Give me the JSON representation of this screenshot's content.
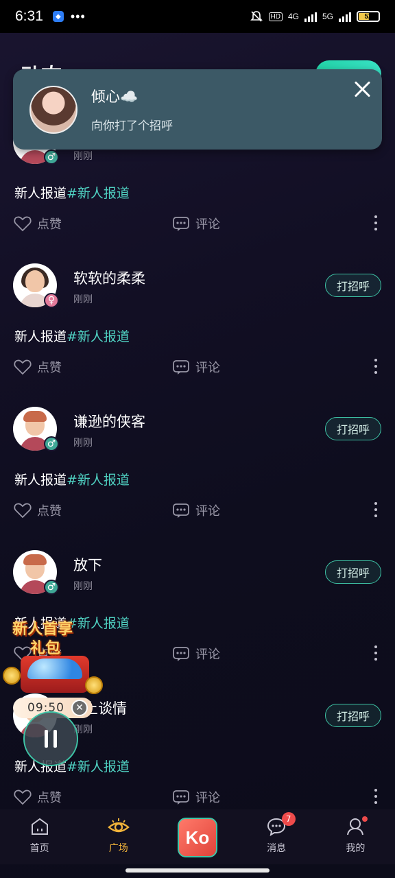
{
  "status_bar": {
    "time": "6:31",
    "network1": "4G",
    "network2": "5G",
    "hd": "HD",
    "battery": "52",
    "battery_percent": 52
  },
  "header": {
    "title": "动态"
  },
  "notification": {
    "name": "倾心☁️",
    "message": "向你打了个招呼"
  },
  "posts": [
    {
      "name": "",
      "time": "刚刚",
      "gender": "male",
      "content": "新人报道",
      "tag": "#新人报道",
      "like_label": "点赞",
      "comment_label": "评论"
    },
    {
      "name": "软软的柔柔",
      "time": "刚刚",
      "gender": "female",
      "greet_label": "打招呼",
      "content": "新人报道",
      "tag": "#新人报道",
      "like_label": "点赞",
      "comment_label": "评论"
    },
    {
      "name": "谦逊的侠客",
      "time": "刚刚",
      "gender": "male",
      "greet_label": "打招呼",
      "content": "新人报道",
      "tag": "#新人报道",
      "like_label": "点赞",
      "comment_label": "评论"
    },
    {
      "name": "放下",
      "time": "刚刚",
      "gender": "male",
      "greet_label": "打招呼",
      "content": "新人报道",
      "tag": "#新人报道",
      "like_label": "点赞",
      "comment_label": "评论"
    },
    {
      "name": "上谈情",
      "time": "刚刚",
      "gender": "male",
      "greet_label": "打招呼",
      "content": "新人报道",
      "tag": "#新人报道",
      "like_label": "点赞",
      "comment_label": "评论"
    }
  ],
  "promo": {
    "title_line1": "新人首享",
    "title_line2": "礼包",
    "timer": "09:50"
  },
  "gender_symbols": {
    "male": "♂",
    "female": "♀"
  },
  "bottom_nav": {
    "home": "首页",
    "square": "广场",
    "center_logo": "Ko",
    "messages": "消息",
    "messages_badge": "7",
    "mine": "我的"
  },
  "colors": {
    "accent": "#3ec4a6",
    "tag": "#4fd0c1",
    "active_nav": "#f1b33a",
    "badge": "#ee4b4b"
  }
}
